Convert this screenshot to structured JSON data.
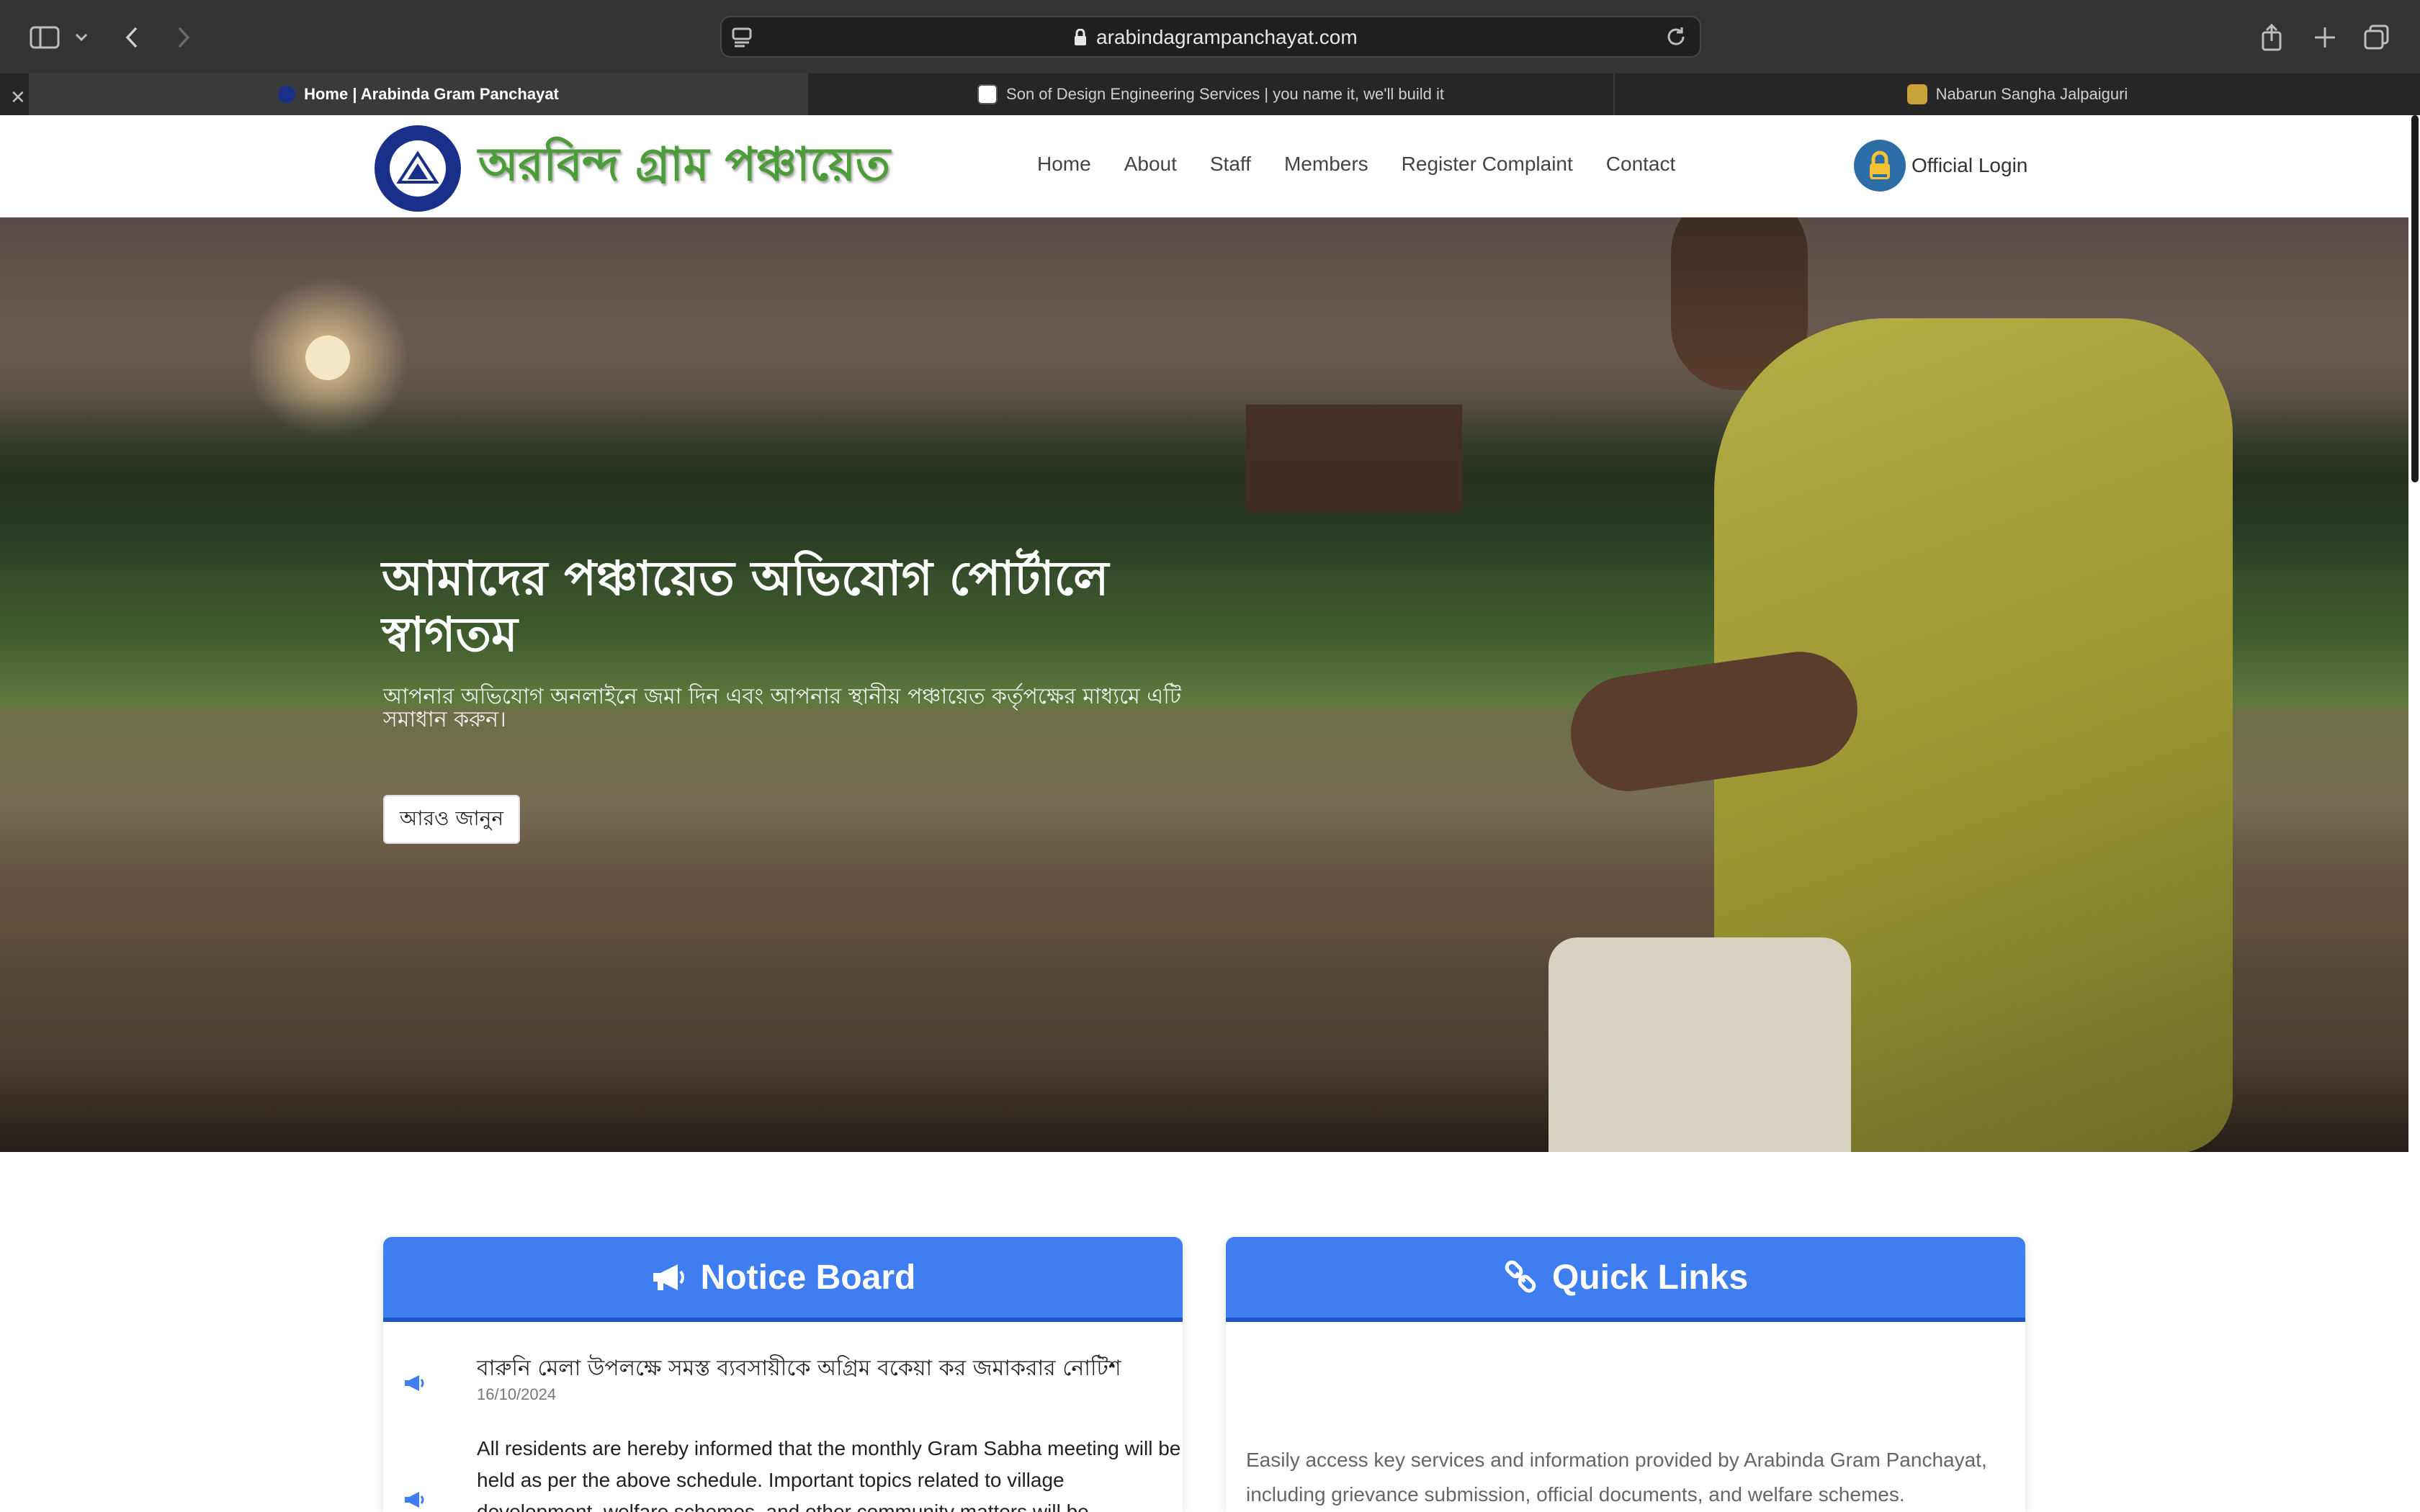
{
  "browser": {
    "url": "arabindagrampanchayat.com",
    "tabs": [
      {
        "label": "Home | Arabinda Gram Panchayat",
        "active": true
      },
      {
        "label": "Son of Design Engineering Services | you name it, we'll build it",
        "active": false
      },
      {
        "label": "Nabarun Sangha Jalpaiguri",
        "active": false
      }
    ]
  },
  "site": {
    "logo_text": "অরবিন্দ গ্রাম পঞ্চায়েত",
    "nav": [
      "Home",
      "About",
      "Staff",
      "Members",
      "Register Complaint",
      "Contact"
    ],
    "login_label": "Official Login"
  },
  "hero": {
    "title": "আমাদের পঞ্চায়েত অভিযোগ পোর্টালে স্বাগতম",
    "subtitle": "আপনার অভিযোগ অনলাইনে জমা দিন এবং আপনার স্থানীয় পঞ্চায়েত কর্তৃপক্ষের মাধ্যমে এটি সমাধান করুন।",
    "button_label": "আরও জানুন"
  },
  "notice_board": {
    "heading": "Notice Board",
    "items": [
      {
        "title": "বারুনি মেলা উপলক্ষে সমস্ত ব্যবসায়ীকে অগ্রিম বকেয়া কর জমাকরার নোটিশ",
        "date": "16/10/2024"
      },
      {
        "body": "All residents are hereby informed that the monthly Gram Sabha meeting will be held as per the above schedule. Important topics related to village development, welfare schemes, and other community matters will be"
      }
    ]
  },
  "quick_links": {
    "heading": "Quick Links",
    "description": "Easily access key services and information provided by Arabinda Gram Panchayat, including grievance submission, official documents, and welfare schemes."
  },
  "colors": {
    "card_header": "#3e7ef1",
    "card_header_border": "#1e55c3",
    "logo_green": "#4d9c3a"
  }
}
